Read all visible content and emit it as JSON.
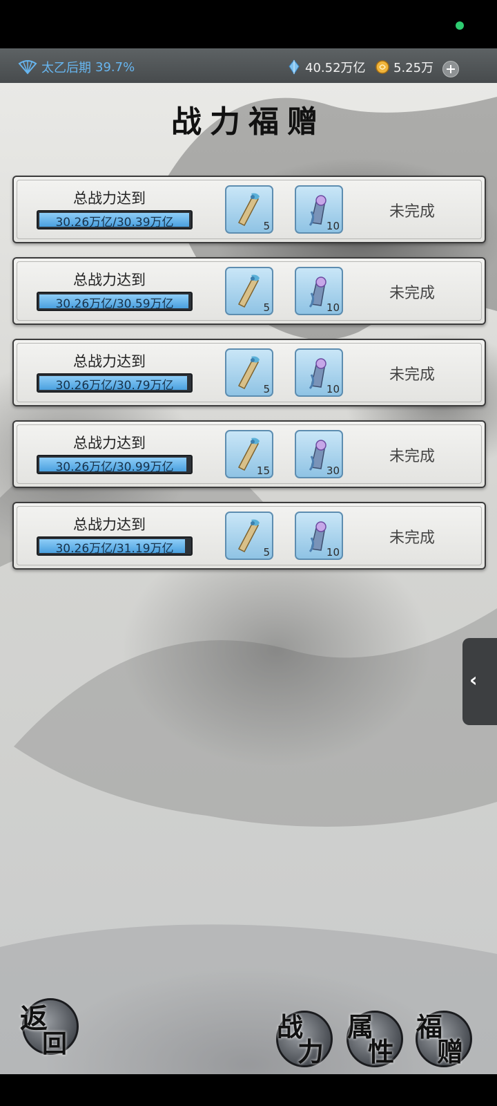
{
  "header": {
    "realm_name": "太乙后期",
    "realm_progress": "39.7%",
    "spirit_stones": "40.52万亿",
    "gold": "5.25万"
  },
  "page": {
    "title": "战力福赠"
  },
  "tasks": [
    {
      "label": "总战力达到",
      "progress_text": "30.26万亿/30.39万亿",
      "progress_fraction": 0.996,
      "reward_a_count": "5",
      "reward_b_count": "10",
      "status": "未完成"
    },
    {
      "label": "总战力达到",
      "progress_text": "30.26万亿/30.59万亿",
      "progress_fraction": 0.989,
      "reward_a_count": "5",
      "reward_b_count": "10",
      "status": "未完成"
    },
    {
      "label": "总战力达到",
      "progress_text": "30.26万亿/30.79万亿",
      "progress_fraction": 0.983,
      "reward_a_count": "5",
      "reward_b_count": "10",
      "status": "未完成"
    },
    {
      "label": "总战力达到",
      "progress_text": "30.26万亿/30.99万亿",
      "progress_fraction": 0.976,
      "reward_a_count": "15",
      "reward_b_count": "30",
      "status": "未完成"
    },
    {
      "label": "总战力达到",
      "progress_text": "30.26万亿/31.19万亿",
      "progress_fraction": 0.97,
      "reward_a_count": "5",
      "reward_b_count": "10",
      "status": "未完成"
    }
  ],
  "nav": {
    "back": [
      "返",
      "回"
    ],
    "power": [
      "战",
      "力"
    ],
    "attributes": [
      "属",
      "性"
    ],
    "gift": [
      "福",
      "赠"
    ],
    "side_toggle": "‹"
  },
  "icons": {
    "realm": "fan-icon",
    "spirit": "crystal-icon",
    "gold": "coin-icon",
    "reward_a": "scroll-icon",
    "reward_b": "token-icon"
  },
  "colors": {
    "realm_text": "#67b6f0",
    "progress_fill": "#4aa0df",
    "status_dot": "#2ecc71"
  }
}
